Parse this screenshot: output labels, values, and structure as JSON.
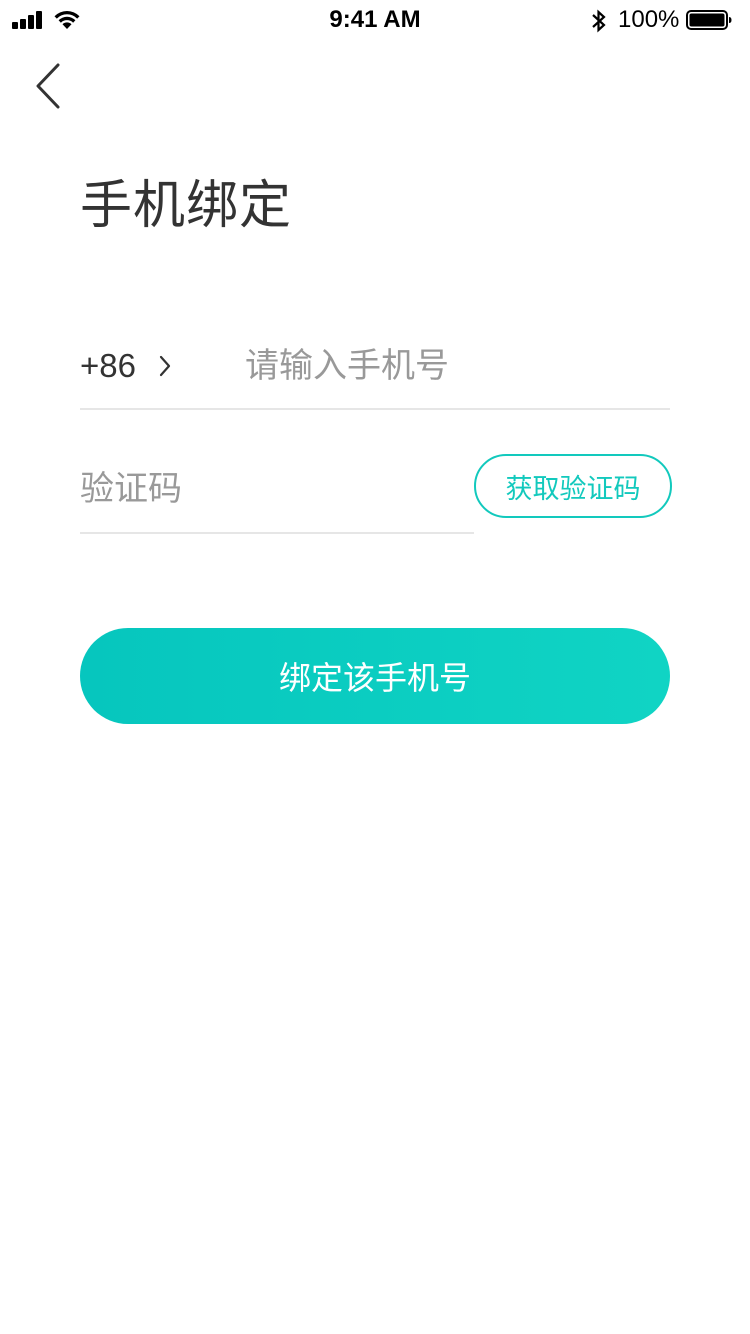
{
  "status_bar": {
    "time": "9:41 AM",
    "battery_percent": "100%",
    "battery_level": 1.0,
    "icons": [
      "signal-icon",
      "wifi-icon",
      "bluetooth-icon",
      "battery-icon"
    ]
  },
  "nav": {
    "back_icon": "chevron-left-icon"
  },
  "page": {
    "title": "手机绑定"
  },
  "phone": {
    "country_code": "+86",
    "country_chevron_icon": "chevron-right-icon",
    "placeholder": "请输入手机号",
    "value": ""
  },
  "verify": {
    "placeholder": "验证码",
    "value": "",
    "get_code_label": "获取验证码"
  },
  "submit": {
    "label": "绑定该手机号"
  },
  "colors": {
    "accent": "#12c9bd",
    "gradient_start": "#06c6be",
    "gradient_end": "#10d4c4",
    "title_text": "#333333",
    "placeholder_text": "#999999",
    "divider": "#e6e6e6"
  }
}
